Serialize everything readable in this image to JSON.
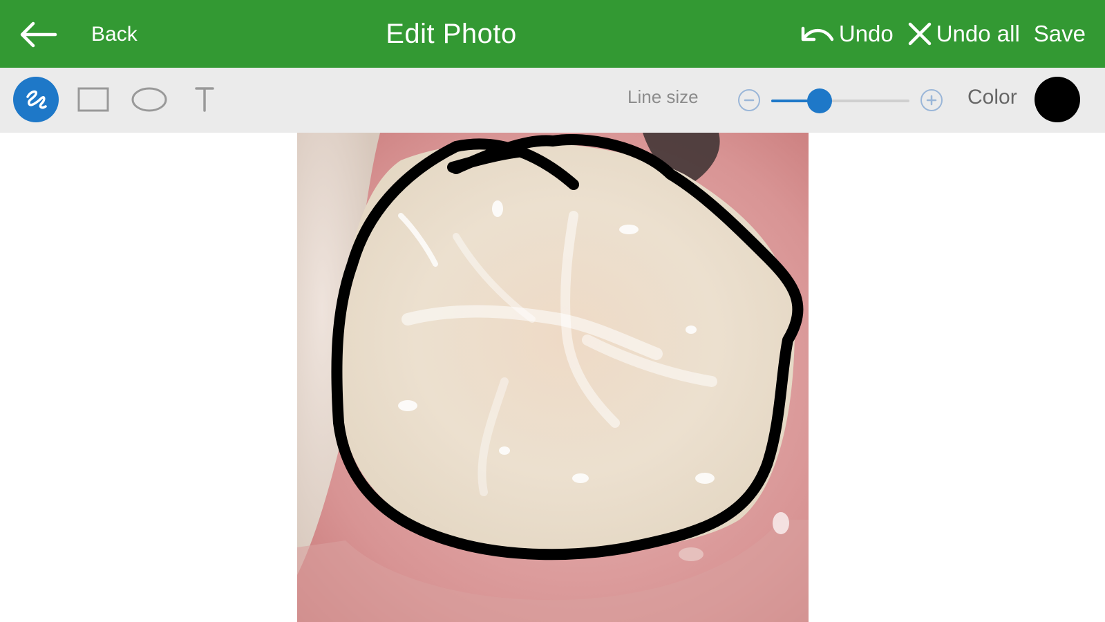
{
  "header": {
    "back_label": "Back",
    "title": "Edit Photo",
    "undo_label": "Undo",
    "undo_all_label": "Undo all",
    "save_label": "Save",
    "background_color": "#339933"
  },
  "toolbar": {
    "tools": [
      {
        "name": "freehand",
        "icon": "freehand-draw-icon",
        "selected": true
      },
      {
        "name": "rectangle",
        "icon": "rectangle-icon",
        "selected": false
      },
      {
        "name": "ellipse",
        "icon": "ellipse-icon",
        "selected": false
      },
      {
        "name": "text",
        "icon": "text-icon",
        "selected": false
      }
    ],
    "line_size_label": "Line size",
    "line_size_fraction": 0.35,
    "color_label": "Color",
    "selected_color": "#000000",
    "accent_color": "#1e78c8"
  },
  "canvas": {
    "subject": "tooth-photo",
    "annotation_color": "#000000"
  }
}
